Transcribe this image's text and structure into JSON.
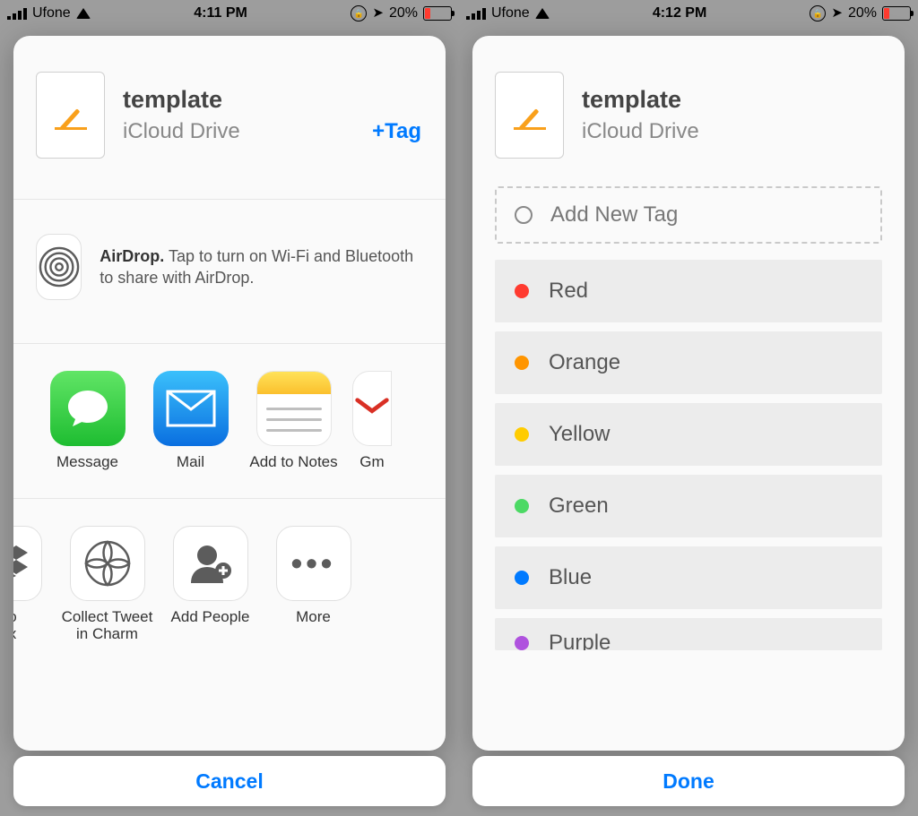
{
  "left": {
    "status": {
      "carrier": "Ufone",
      "time": "4:11 PM",
      "battery": "20%"
    },
    "header": {
      "title": "template",
      "subtitle": "iCloud Drive",
      "tag_button": "+Tag"
    },
    "airdrop": {
      "bold": "AirDrop.",
      "rest": " Tap to turn on Wi-Fi and Bluetooth to share with AirDrop."
    },
    "share": {
      "message": "Message",
      "mail": "Mail",
      "notes": "Add to Notes",
      "gmail_cut": "Gm"
    },
    "actions": {
      "dropbox_line1": "e to",
      "dropbox_line2": "box",
      "charm_line1": "Collect Tweet",
      "charm_line2": "in Charm",
      "addpeople": "Add People",
      "more": "More"
    },
    "footer": "Cancel"
  },
  "right": {
    "status": {
      "carrier": "Ufone",
      "time": "4:12 PM",
      "battery": "20%"
    },
    "header": {
      "title": "template",
      "subtitle": "iCloud Drive"
    },
    "add_new": "Add New Tag",
    "tags": [
      {
        "label": "Red",
        "color": "#ff3b30"
      },
      {
        "label": "Orange",
        "color": "#ff9500"
      },
      {
        "label": "Yellow",
        "color": "#ffcc00"
      },
      {
        "label": "Green",
        "color": "#4cd964"
      },
      {
        "label": "Blue",
        "color": "#007aff"
      },
      {
        "label": "Purple",
        "color": "#af52de"
      }
    ],
    "footer": "Done"
  }
}
